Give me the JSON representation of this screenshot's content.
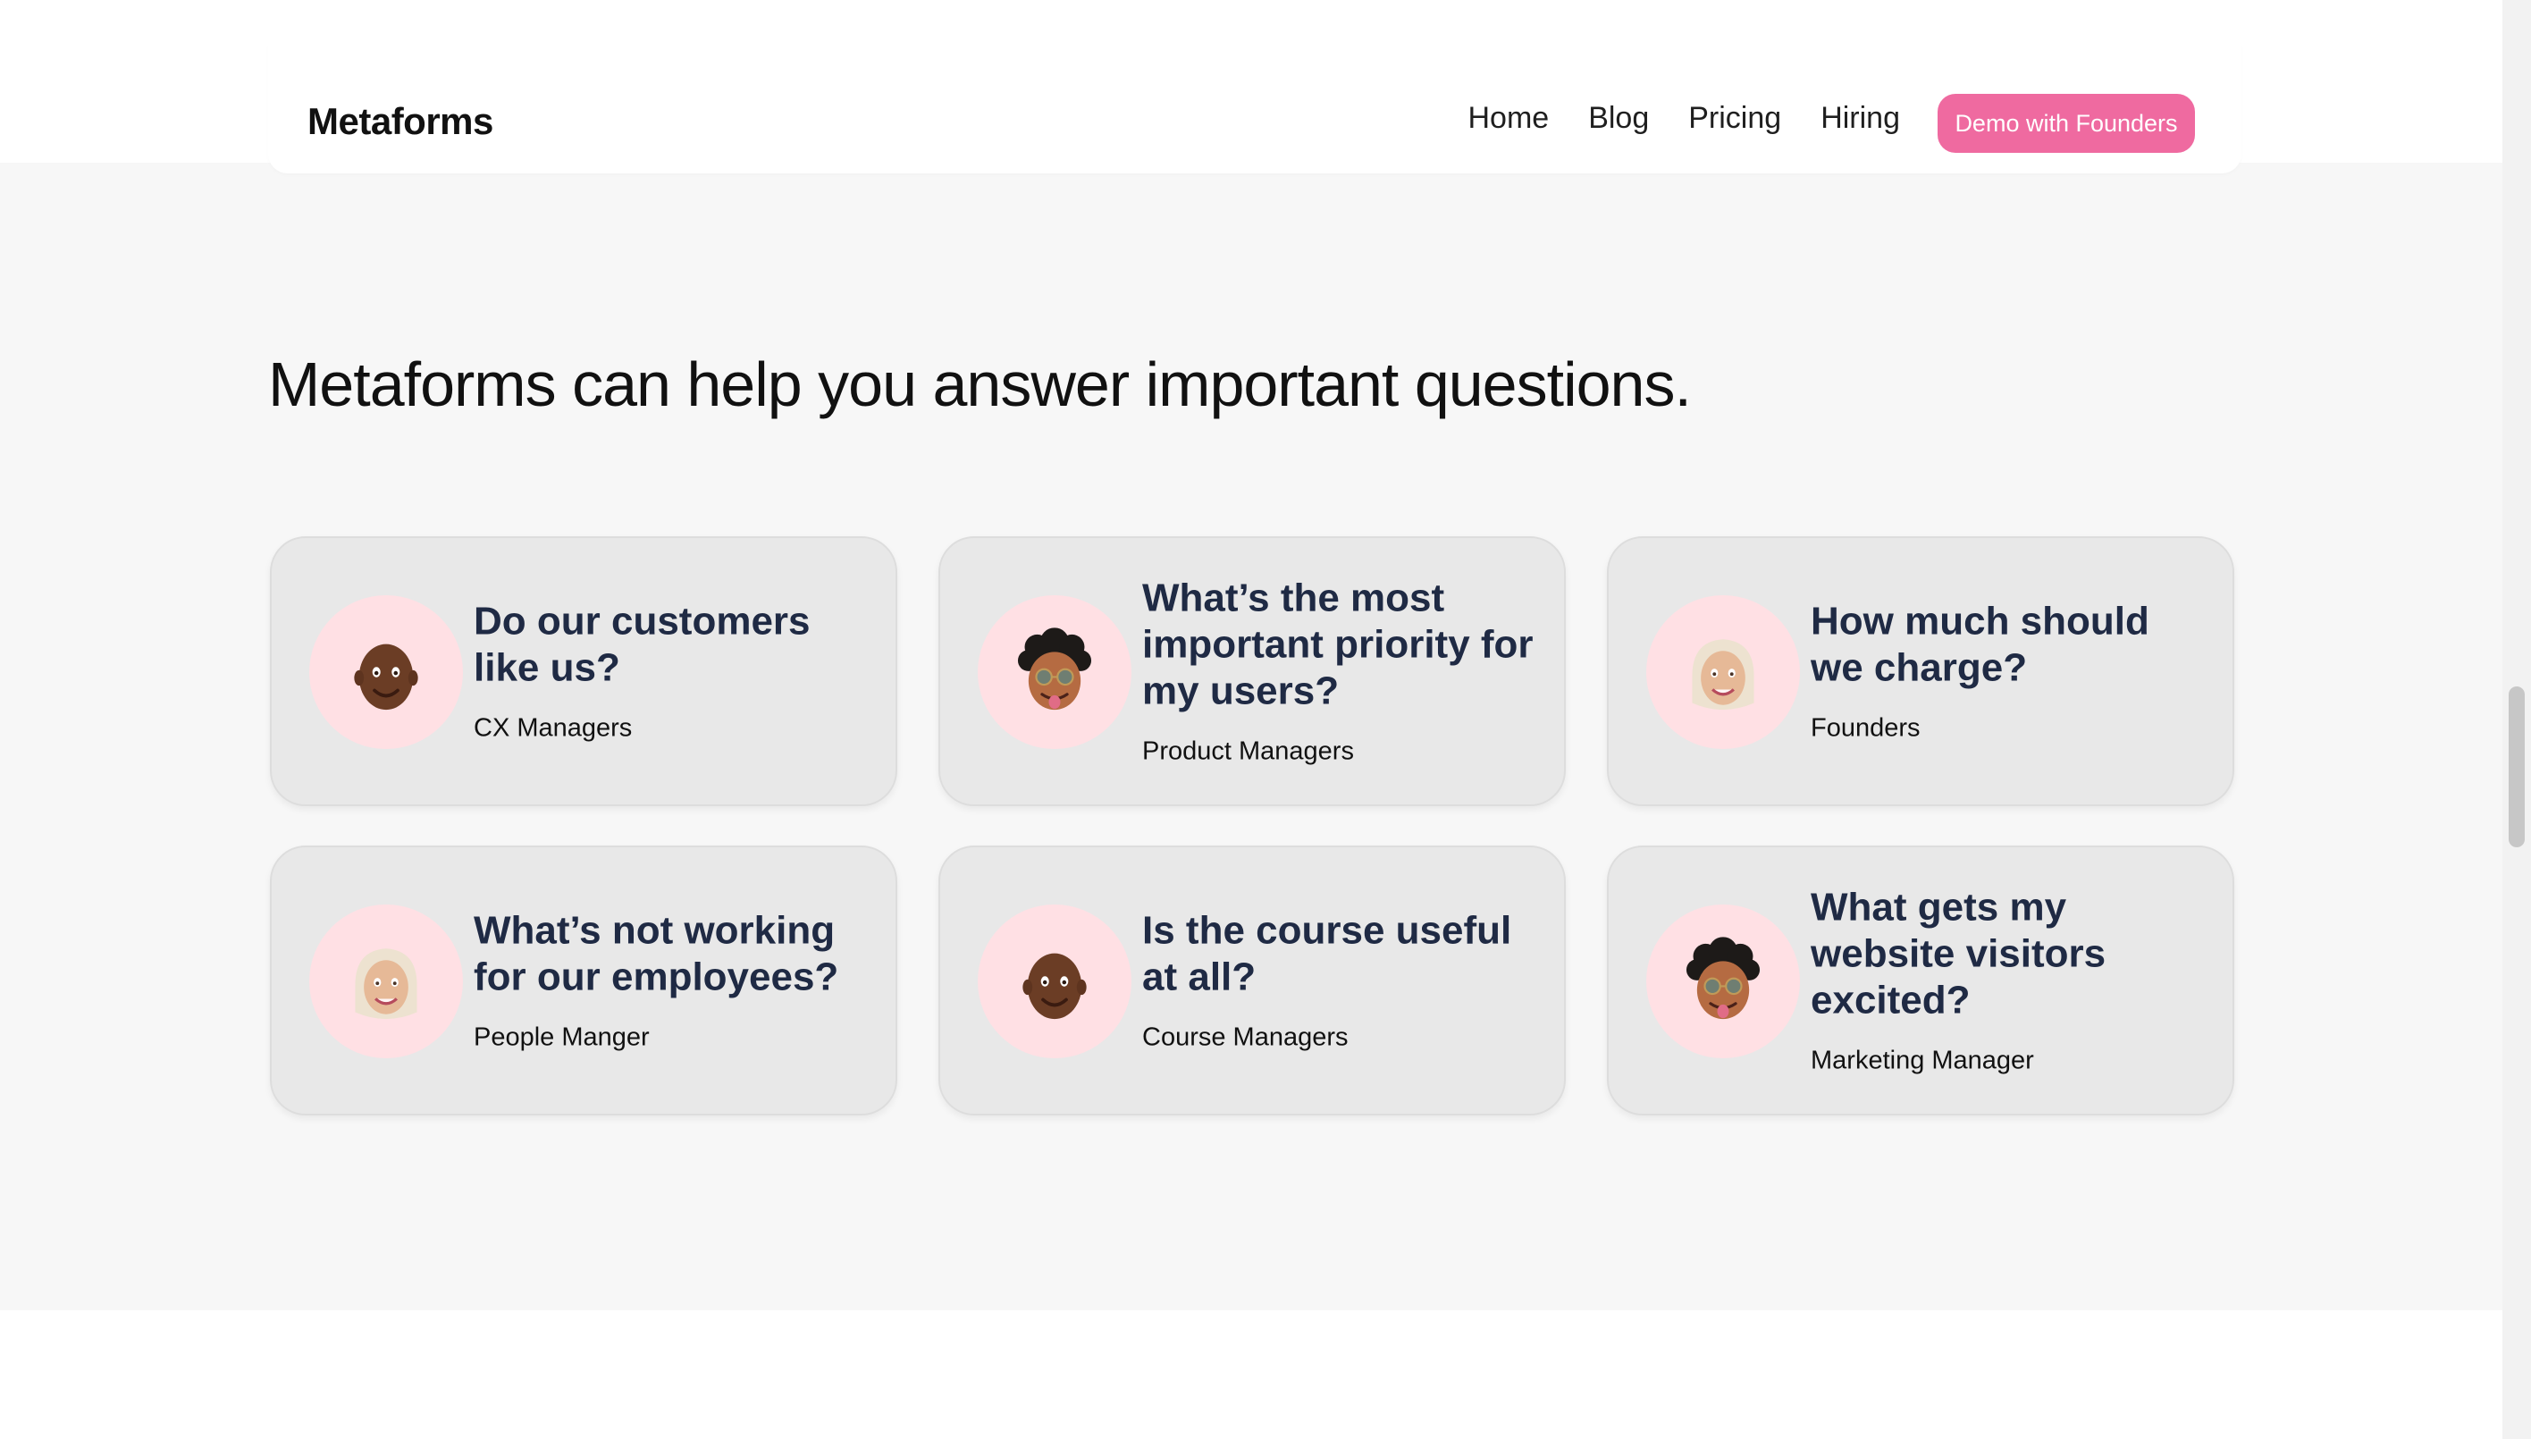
{
  "brand": {
    "name": "Metaforms"
  },
  "nav": {
    "links": [
      "Home",
      "Blog",
      "Pricing",
      "Hiring"
    ],
    "cta": "Demo with Founders"
  },
  "hero": {
    "headline": "Metaforms can help you answer important questions."
  },
  "cards": [
    {
      "question": "Do our customers like us?",
      "role": "CX Managers",
      "avatar": "memoji-man-bald-icon"
    },
    {
      "question": "What’s the most important priority for my users?",
      "role": "Product Managers",
      "avatar": "memoji-curly-hair-sunglasses-icon"
    },
    {
      "question": "How much should we charge?",
      "role": "Founders",
      "avatar": "memoji-hijab-woman-icon"
    },
    {
      "question": "What’s not working for our employees?",
      "role": "People Manger",
      "avatar": "memoji-hijab-woman-icon"
    },
    {
      "question": "Is the course useful at all?",
      "role": "Course Managers",
      "avatar": "memoji-man-bald-icon"
    },
    {
      "question": "What gets my website visitors excited?",
      "role": "Marketing Manager",
      "avatar": "memoji-curly-hair-sunglasses-icon"
    }
  ]
}
